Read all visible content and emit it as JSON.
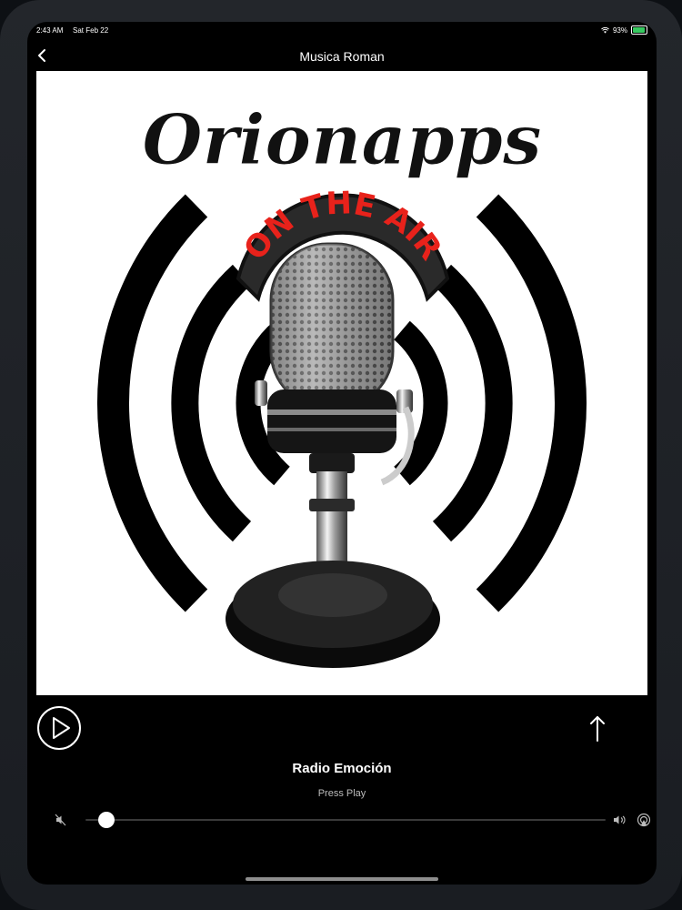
{
  "status_bar": {
    "time": "2:43 AM",
    "date": "Sat Feb 22",
    "battery": "93%"
  },
  "nav": {
    "title": "Musica Roman"
  },
  "artwork": {
    "logo_text": "Orionapps",
    "badge_text": "ON THE AIR"
  },
  "player": {
    "station_name": "Radio Emoción",
    "status": "Press Play",
    "volume_level": 0.04
  },
  "icons": {
    "back": "chevron-left-icon",
    "play": "play-icon",
    "share": "share-icon",
    "volume_low": "speaker-muted-icon",
    "volume_high": "speaker-wave-icon",
    "airplay": "airplay-icon",
    "wifi": "wifi-icon",
    "battery": "battery-icon"
  },
  "colors": {
    "badge_red": "#e8221b",
    "battery_green": "#36c95f"
  }
}
